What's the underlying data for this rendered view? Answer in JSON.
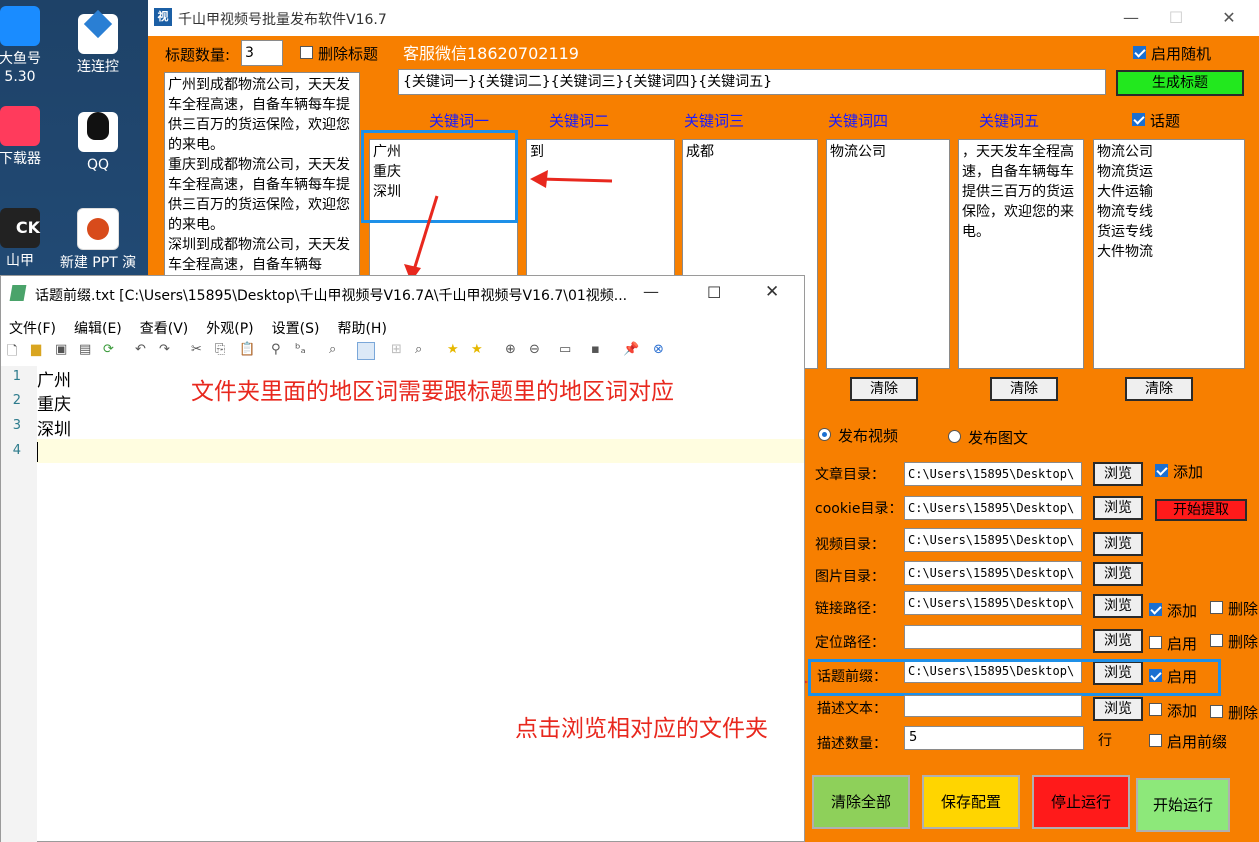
{
  "desktop": {
    "icons": [
      {
        "label": "大鱼号\n5.30"
      },
      {
        "label": "连连控"
      },
      {
        "label": "下载器"
      },
      {
        "label": "QQ"
      },
      {
        "label": "山甲"
      },
      {
        "label": "新建 PPT 演"
      }
    ],
    "partial_icon_text": "CK"
  },
  "app": {
    "title": "千山甲视频号批量发布软件V16.7",
    "icon_char": "视",
    "title_count_label": "标题数量:",
    "title_count_value": "3",
    "delete_title_label": "删除标题",
    "service_wechat": "客服微信18620702119",
    "enable_random_label": "启用随机",
    "keyword_template": "{关键词一}{关键词二}{关键词三}{关键词四}{关键词五}",
    "generate_title_button": "生成标题",
    "titles_text": "广州到成都物流公司，天天发车全程高速，自备车辆每车提供三百万的货运保险，欢迎您的来电。\n重庆到成都物流公司，天天发车全程高速，自备车辆每车提供三百万的货运保险，欢迎您的来电。\n深圳到成都物流公司，天天发车全程高速，自备车辆每",
    "keyword_headers": [
      "关键词一",
      "关键词二",
      "关键词三",
      "关键词四",
      "关键词五"
    ],
    "topic_label": "话题",
    "keyword_lists": [
      "广州\n重庆\n深圳",
      "到",
      "成都",
      "物流公司",
      "，天天发车全程高速，自备车辆每车提供三百万的货运保险，欢迎您的来电。"
    ],
    "topic_list": "物流公司\n物流货运\n大件运输\n物流专线\n货运专线\n大件物流",
    "clear_label": "清除",
    "publish_video": "发布视频",
    "publish_image": "发布图文",
    "rows": [
      {
        "label": "文章目录：",
        "value": "C:\\Users\\15895\\Desktop\\",
        "button": "浏览"
      },
      {
        "label": "cookie目录：",
        "value": "C:\\Users\\15895\\Desktop\\",
        "button": "浏览"
      },
      {
        "label": "视频目录：",
        "value": "C:\\Users\\15895\\Desktop\\",
        "button": "浏览"
      },
      {
        "label": "图片目录：",
        "value": "C:\\Users\\15895\\Desktop\\",
        "button": "浏览"
      },
      {
        "label": "链接路径：",
        "value": "C:\\Users\\15895\\Desktop\\",
        "button": "浏览"
      },
      {
        "label": "定位路径：",
        "value": "",
        "button": "浏览"
      },
      {
        "label": "话题前缀：",
        "value": "C:\\Users\\15895\\Desktop\\",
        "button": "浏览"
      },
      {
        "label": "描述文本：",
        "value": "",
        "button": "浏览"
      },
      {
        "label": "描述数量：",
        "value": "5",
        "button": ""
      }
    ],
    "add_label": "添加",
    "start_extract": "开始提取",
    "delete_label": "删除",
    "enable_label": "启用",
    "lines_label": "行",
    "enable_prefix_label": "启用前缀",
    "bottom_buttons": [
      {
        "label": "清除全部",
        "color": "#8ed05a"
      },
      {
        "label": "保存配置",
        "color": "#ffd500"
      },
      {
        "label": "停止运行",
        "color": "#ff1a1a"
      },
      {
        "label": "开始运行",
        "color": "#8de87a"
      }
    ]
  },
  "notepad": {
    "title": "话题前缀.txt [C:\\Users\\15895\\Desktop\\千山甲视频号V16.7A\\千山甲视频号V16.7\\01视频...",
    "menu": [
      "文件(F)",
      "编辑(E)",
      "查看(V)",
      "外观(P)",
      "设置(S)",
      "帮助(H)"
    ],
    "lines": [
      "广州",
      "重庆",
      "深圳",
      ""
    ],
    "line_numbers": [
      "1",
      "2",
      "3",
      "4"
    ]
  },
  "annotations": {
    "note1": "文件夹里面的地区词需要跟标题里的地区词对应",
    "note2": "点击浏览相对应的文件夹"
  },
  "colors": {
    "app_bg": "#f77f00",
    "keyword_header": "#1a1aff",
    "annotation": "#e8281e",
    "highlight": "#1e90e8"
  }
}
